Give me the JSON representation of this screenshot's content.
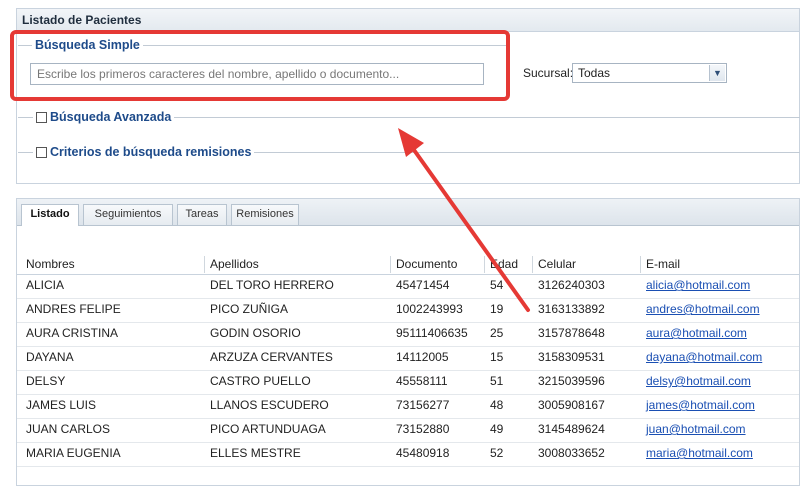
{
  "panel": {
    "title": "Listado de Pacientes"
  },
  "simple": {
    "legend": "Búsqueda Simple",
    "search_placeholder": "Escribe los primeros caracteres del nombre, apellido o documento...",
    "sucursal_label": "Sucursal:",
    "sucursal_value": "Todas"
  },
  "advanced": {
    "legend": "Búsqueda Avanzada"
  },
  "criteria": {
    "legend": "Criterios de búsqueda remisiones"
  },
  "tabs": [
    "Listado",
    "Seguimientos",
    "Tareas",
    "Remisiones"
  ],
  "columns": [
    "Nombres",
    "Apellidos",
    "Documento",
    "Edad",
    "Celular",
    "E-mail"
  ],
  "rows": [
    [
      "ALICIA",
      "DEL TORO HERRERO",
      "45471454",
      "54",
      "3126240303",
      "alicia@hotmail.com"
    ],
    [
      "ANDRES FELIPE",
      "PICO ZUÑIGA",
      "1002243993",
      "19",
      "3163133892",
      "andres@hotmail.com"
    ],
    [
      "AURA CRISTINA",
      "GODIN OSORIO",
      "95111406635",
      "25",
      "3157878648",
      "aura@hotmail.com"
    ],
    [
      "DAYANA",
      "ARZUZA CERVANTES",
      "14112005",
      "15",
      "3158309531",
      "dayana@hotmail.com"
    ],
    [
      "DELSY",
      "CASTRO PUELLO",
      "45558111",
      "51",
      "3215039596",
      "delsy@hotmail.com"
    ],
    [
      "JAMES LUIS",
      "LLANOS ESCUDERO",
      "73156277",
      "48",
      "3005908167",
      "james@hotmail.com"
    ],
    [
      "JUAN CARLOS",
      "PICO ARTUNDUAGA",
      "73152880",
      "49",
      "3145489624",
      "juan@hotmail.com"
    ],
    [
      "MARIA EUGENIA",
      "ELLES MESTRE",
      "45480918",
      "52",
      "3008033652",
      "maria@hotmail.com"
    ]
  ],
  "colors": {
    "highlight": "#e53935",
    "legend": "#1e4b8a",
    "link": "#1a4fb3"
  },
  "icons": {
    "select_arrow": "chevron-down-icon",
    "annotation": "arrow-annotation-icon"
  }
}
